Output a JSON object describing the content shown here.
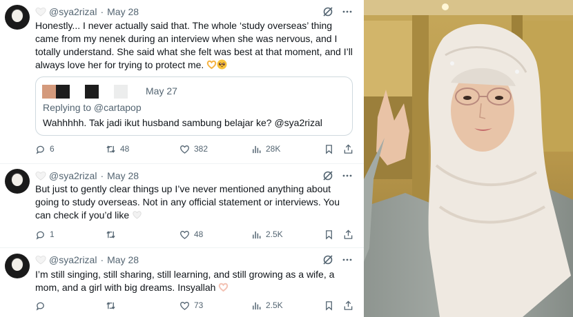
{
  "tweets": [
    {
      "handle": "@sya2rizal",
      "date": "May 28",
      "text": "Honestly... I never actually said that. The whole ‘study overseas’ thing came from my nenek during an interview when she was nervous, and I totally understand. She said what she felt was best at that moment, and I’ll always love her for trying to protect me.",
      "quote": {
        "date": "May 27",
        "replying": "Replying to @cartapop",
        "text": "Wahhhhh. Tak jadi ikut husband sambung belajar ke? @sya2rizal"
      },
      "stats": {
        "replies": "6",
        "reposts": "48",
        "likes": "382",
        "views": "28K"
      }
    },
    {
      "handle": "@sya2rizal",
      "date": "May 28",
      "text": "But just to gently clear things up I’ve never mentioned anything about going to study overseas. Not in any official statement or interviews. You can check if you’d like",
      "stats": {
        "replies": "1",
        "reposts": "",
        "likes": "48",
        "views": "2.5K"
      }
    },
    {
      "handle": "@sya2rizal",
      "date": "May 28",
      "text": "I’m still singing, still sharing, still learning, and still growing as a wife, a mom, and a girl with big dreams. Insyallah",
      "stats": {
        "replies": "",
        "reposts": "",
        "likes": "73",
        "views": "2.5K"
      }
    }
  ],
  "colors": {
    "text": "#0f1419",
    "muted": "#536471",
    "border": "#cfd9de"
  },
  "icons": [
    "white-heart-icon",
    "grok-icon",
    "more-icon",
    "reply-icon",
    "repost-icon",
    "like-icon",
    "views-icon",
    "bookmark-icon",
    "share-icon",
    "heart-hands-emoji",
    "pleading-face-emoji"
  ]
}
